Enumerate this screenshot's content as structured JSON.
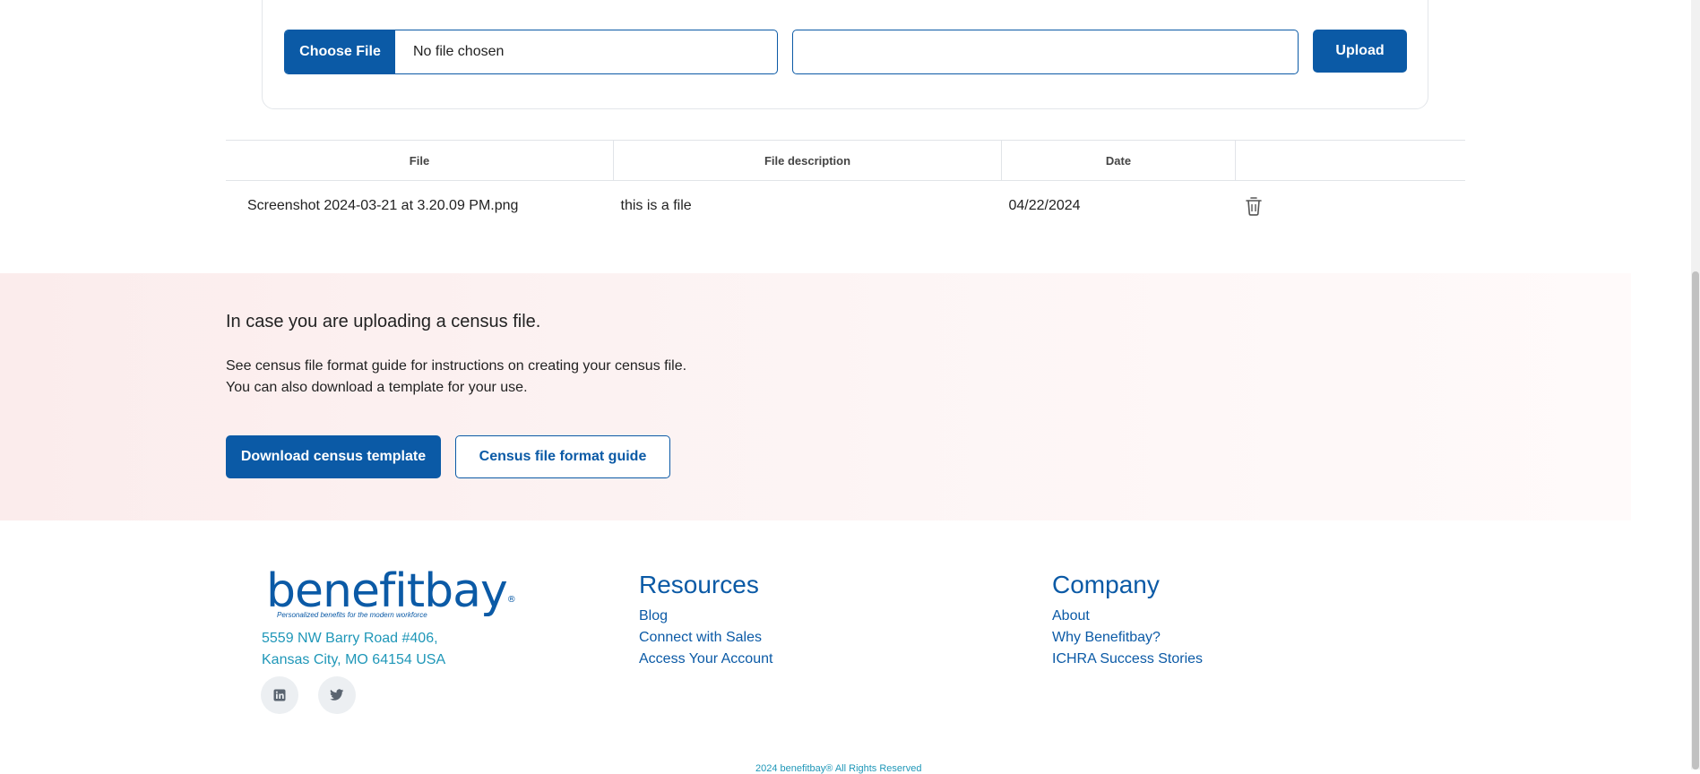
{
  "upload": {
    "choose_label": "Choose File",
    "file_status": "No file chosen",
    "description_value": "",
    "upload_label": "Upload"
  },
  "table": {
    "headers": [
      "File",
      "File description",
      "Date",
      ""
    ],
    "rows": [
      {
        "file": "Screenshot 2024-03-21 at 3.20.09 PM.png",
        "description": "this is a file",
        "date": "04/22/2024"
      }
    ]
  },
  "census": {
    "title": "In case you are uploading a census file.",
    "line1": "See census file format guide for instructions on creating your census file.",
    "line2": "You can also download a template for your use.",
    "download_label": "Download census template",
    "guide_label": "Census file format guide"
  },
  "footer": {
    "logo_text": "benefitbay",
    "logo_reg": "®",
    "logo_tagline": "Personalized benefits for the modern workforce",
    "address_line1": "5559 NW Barry Road #406,",
    "address_line2": "Kansas City, MO 64154 USA",
    "resources": {
      "heading": "Resources",
      "links": [
        "Blog",
        "Connect with Sales",
        "Access Your Account"
      ]
    },
    "company": {
      "heading": "Company",
      "links": [
        "About",
        "Why Benefitbay?",
        "ICHRA Success Stories"
      ]
    },
    "copyright": "2024 benefitbay® All Rights Reserved"
  },
  "colors": {
    "brand_blue": "#0b5aa6",
    "teal_text": "#1f97b8",
    "census_bg": "#fbecec"
  },
  "icons": {
    "delete": "trash-icon",
    "linkedin": "linkedin-icon",
    "twitter": "twitter-icon"
  }
}
